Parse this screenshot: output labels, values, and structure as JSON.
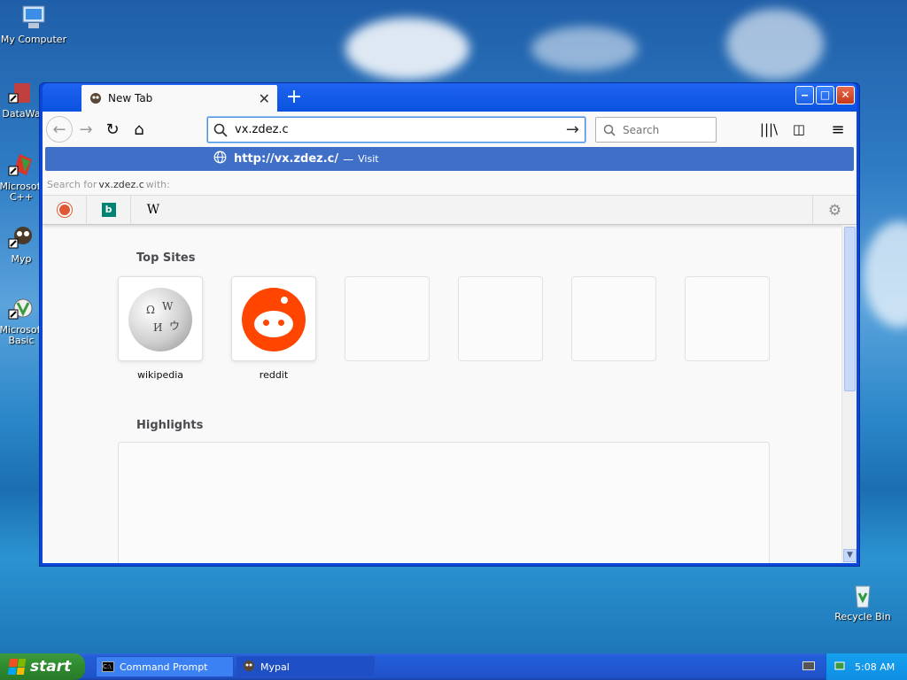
{
  "desktop": {
    "icons": [
      {
        "label": "My Computer"
      },
      {
        "label": "DataWa"
      },
      {
        "label": "Microsofl C++"
      },
      {
        "label": "Myp"
      },
      {
        "label": "Microsofl Basic"
      },
      {
        "label": "Recycle Bin"
      }
    ]
  },
  "browser": {
    "tab": {
      "title": "New Tab",
      "close": "✕"
    },
    "new_tab": "+",
    "window_buttons": {
      "minimize": "‒",
      "maximize": "□",
      "close": "✕"
    },
    "nav": {
      "back": "←",
      "forward": "→",
      "reload": "↻",
      "home": "⌂",
      "go": "→"
    },
    "url": {
      "value": "vx.zdez.c"
    },
    "search": {
      "placeholder": "Search"
    },
    "toolbar": {
      "library": "|||\\",
      "sidebar": "◫",
      "menu": "≡"
    },
    "suggestion": {
      "url": "http://vx.zdez.c/",
      "separator": "—",
      "action": "Visit"
    },
    "search_with": {
      "prefix": "Search for",
      "query": "vx.zdez.c",
      "suffix": "with:"
    },
    "engines": [
      "DuckDuckGo",
      "Bing",
      "Wikipedia"
    ],
    "engine_glyphs": {
      "bing": "b",
      "wikipedia": "W"
    },
    "settings_glyph": "⚙",
    "page": {
      "top_sites_title": "Top Sites",
      "top_sites": [
        {
          "label": "wikipedia"
        },
        {
          "label": "reddit"
        },
        {
          "label": ""
        },
        {
          "label": ""
        },
        {
          "label": ""
        },
        {
          "label": ""
        }
      ],
      "highlights_title": "Highlights"
    },
    "scroll_down": "▼"
  },
  "taskbar": {
    "start": "start",
    "items": [
      {
        "label": "Command Prompt"
      },
      {
        "label": "Mypal"
      }
    ],
    "clock": "5:08 AM"
  },
  "colors": {
    "accent": "#3f6fc6",
    "reddit": "#ff4500",
    "taskbar": "#245edb"
  }
}
